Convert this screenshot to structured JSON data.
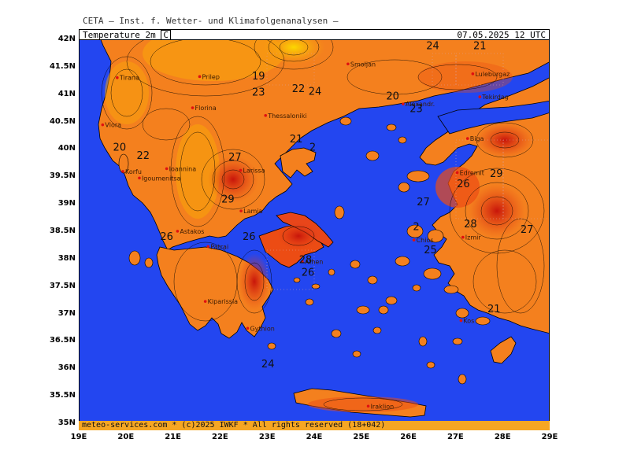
{
  "header": {
    "title": "CETA — Inst. f. Wetter- und Klimafolgenanalysen —"
  },
  "panel": {
    "variable": "Temperature 2m",
    "unit": "C",
    "valid_time": "07.05.2025 12 UTC"
  },
  "footer": {
    "credit": "meteo-services.com * (c)2025 IWKF * All rights reserved (18+042)"
  },
  "axes": {
    "lat_labels": [
      "42N",
      "41.5N",
      "41N",
      "40.5N",
      "40N",
      "39.5N",
      "39N",
      "38.5N",
      "38N",
      "37.5N",
      "37N",
      "36.5N",
      "36N",
      "35.5N",
      "35N"
    ],
    "lon_labels": [
      "19E",
      "20E",
      "21E",
      "22E",
      "23E",
      "24E",
      "25E",
      "26E",
      "27E",
      "28E",
      "29E"
    ]
  },
  "cities": [
    {
      "name": "Tirana",
      "lon": 19.8,
      "lat": 41.33
    },
    {
      "name": "Prilep",
      "lon": 21.55,
      "lat": 41.35
    },
    {
      "name": "Smoljan",
      "lon": 24.7,
      "lat": 41.58
    },
    {
      "name": "Luleburgaz",
      "lon": 27.35,
      "lat": 41.4
    },
    {
      "name": "Tekirdag",
      "lon": 27.5,
      "lat": 40.98
    },
    {
      "name": "Florina",
      "lon": 21.4,
      "lat": 40.78
    },
    {
      "name": "Thessaloniki",
      "lon": 22.95,
      "lat": 40.64
    },
    {
      "name": "Alexandr.",
      "lon": 25.87,
      "lat": 40.85
    },
    {
      "name": "Vlora",
      "lon": 19.49,
      "lat": 40.47
    },
    {
      "name": "Biga",
      "lon": 27.24,
      "lat": 40.22
    },
    {
      "name": "Korfu",
      "lon": 19.92,
      "lat": 39.62
    },
    {
      "name": "Ioannina",
      "lon": 20.85,
      "lat": 39.67
    },
    {
      "name": "Igoumenitsa",
      "lon": 20.27,
      "lat": 39.5
    },
    {
      "name": "Larissa",
      "lon": 22.42,
      "lat": 39.64
    },
    {
      "name": "Edremit",
      "lon": 27.02,
      "lat": 39.6
    },
    {
      "name": "Lamia",
      "lon": 22.43,
      "lat": 38.9
    },
    {
      "name": "Astakos",
      "lon": 21.08,
      "lat": 38.53
    },
    {
      "name": "Izmir",
      "lon": 27.14,
      "lat": 38.42
    },
    {
      "name": "Chios",
      "lon": 26.1,
      "lat": 38.37
    },
    {
      "name": "Patrai",
      "lon": 21.73,
      "lat": 38.25
    },
    {
      "name": "Athen",
      "lon": 23.73,
      "lat": 37.98
    },
    {
      "name": "Kos",
      "lon": 27.1,
      "lat": 36.9
    },
    {
      "name": "Kiparissia",
      "lon": 21.67,
      "lat": 37.25
    },
    {
      "name": "Gythion",
      "lon": 22.57,
      "lat": 36.76
    },
    {
      "name": "Iraklion",
      "lon": 25.13,
      "lat": 35.34
    }
  ],
  "contour_labels": [
    {
      "value": "24",
      "lon": 26.5,
      "lat": 41.85
    },
    {
      "value": "21",
      "lon": 27.5,
      "lat": 41.85
    },
    {
      "value": "19",
      "lon": 22.8,
      "lat": 41.3
    },
    {
      "value": "23",
      "lon": 22.8,
      "lat": 41.0
    },
    {
      "value": "22",
      "lon": 23.65,
      "lat": 41.07
    },
    {
      "value": "24",
      "lon": 24.0,
      "lat": 41.02
    },
    {
      "value": "20",
      "lon": 25.65,
      "lat": 40.93
    },
    {
      "value": "23",
      "lon": 26.15,
      "lat": 40.7
    },
    {
      "value": "21",
      "lon": 23.6,
      "lat": 40.15
    },
    {
      "value": "2",
      "lon": 23.95,
      "lat": 40.0
    },
    {
      "value": "20",
      "lon": 19.85,
      "lat": 40.0
    },
    {
      "value": "22",
      "lon": 20.35,
      "lat": 39.85
    },
    {
      "value": "27",
      "lon": 22.3,
      "lat": 39.82
    },
    {
      "value": "29",
      "lon": 22.15,
      "lat": 39.05
    },
    {
      "value": "26",
      "lon": 27.15,
      "lat": 39.33
    },
    {
      "value": "29",
      "lon": 27.85,
      "lat": 39.52
    },
    {
      "value": "27",
      "lon": 26.3,
      "lat": 39.0
    },
    {
      "value": "2",
      "lon": 26.15,
      "lat": 38.55
    },
    {
      "value": "28",
      "lon": 27.3,
      "lat": 38.6
    },
    {
      "value": "27",
      "lon": 28.5,
      "lat": 38.5
    },
    {
      "value": "26",
      "lon": 22.6,
      "lat": 38.37
    },
    {
      "value": "25",
      "lon": 26.45,
      "lat": 38.13
    },
    {
      "value": "28",
      "lon": 23.8,
      "lat": 37.95
    },
    {
      "value": "26",
      "lon": 23.85,
      "lat": 37.72
    },
    {
      "value": "26",
      "lon": 20.85,
      "lat": 38.37
    },
    {
      "value": "21",
      "lon": 27.8,
      "lat": 37.05
    },
    {
      "value": "24",
      "lon": 23.0,
      "lat": 36.05
    }
  ],
  "colors": {
    "sea": "#2346f0",
    "land_base": "#f4801e",
    "warm": "#ec4c14",
    "hot": "#d81b0b",
    "cool": "#f8a40a",
    "cold": "#fcd000"
  }
}
